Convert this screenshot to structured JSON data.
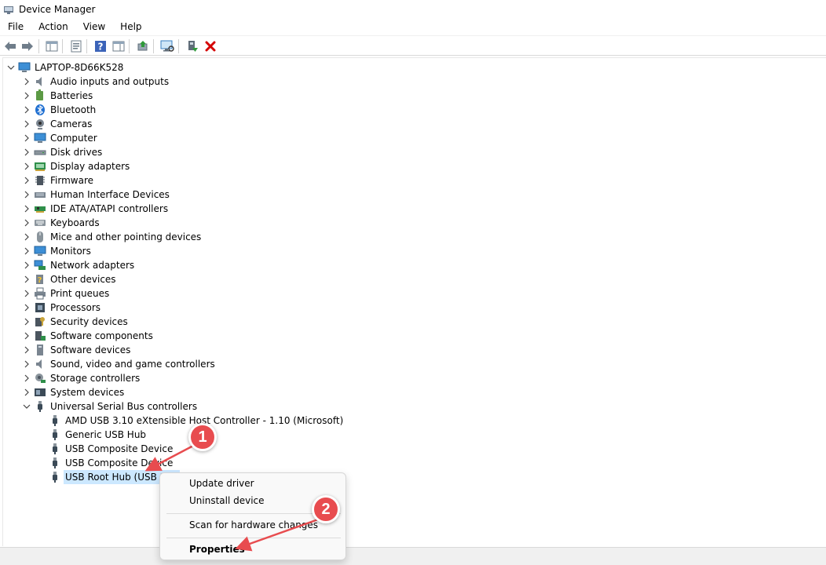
{
  "window": {
    "title": "Device Manager"
  },
  "menu": [
    "File",
    "Action",
    "View",
    "Help"
  ],
  "toolbar": {
    "buttons": [
      "back-icon",
      "forward-icon",
      "show-hide-console-tree-icon",
      "properties-icon",
      "help-icon",
      "action-pane-icon",
      "update-driver-icon",
      "scan-hardware-icon",
      "enable-device-icon",
      "uninstall-device-icon"
    ]
  },
  "tree": {
    "root": "LAPTOP-8D66K528",
    "categories": [
      {
        "label": "Audio inputs and outputs",
        "icon": "speaker-icon"
      },
      {
        "label": "Batteries",
        "icon": "battery-icon"
      },
      {
        "label": "Bluetooth",
        "icon": "bluetooth-icon"
      },
      {
        "label": "Cameras",
        "icon": "camera-icon"
      },
      {
        "label": "Computer",
        "icon": "computer-icon"
      },
      {
        "label": "Disk drives",
        "icon": "disk-drive-icon"
      },
      {
        "label": "Display adapters",
        "icon": "display-adapter-icon"
      },
      {
        "label": "Firmware",
        "icon": "firmware-icon"
      },
      {
        "label": "Human Interface Devices",
        "icon": "hid-icon"
      },
      {
        "label": "IDE ATA/ATAPI controllers",
        "icon": "ide-controller-icon"
      },
      {
        "label": "Keyboards",
        "icon": "keyboard-icon"
      },
      {
        "label": "Mice and other pointing devices",
        "icon": "mouse-icon"
      },
      {
        "label": "Monitors",
        "icon": "monitor-icon"
      },
      {
        "label": "Network adapters",
        "icon": "network-adapter-icon"
      },
      {
        "label": "Other devices",
        "icon": "other-devices-icon"
      },
      {
        "label": "Print queues",
        "icon": "printer-icon"
      },
      {
        "label": "Processors",
        "icon": "processor-icon"
      },
      {
        "label": "Security devices",
        "icon": "security-device-icon"
      },
      {
        "label": "Software components",
        "icon": "software-component-icon"
      },
      {
        "label": "Software devices",
        "icon": "software-device-icon"
      },
      {
        "label": "Sound, video and game controllers",
        "icon": "sound-controller-icon"
      },
      {
        "label": "Storage controllers",
        "icon": "storage-controller-icon"
      },
      {
        "label": "System devices",
        "icon": "system-devices-icon"
      },
      {
        "label": "Universal Serial Bus controllers",
        "icon": "usb-icon"
      }
    ],
    "usb_children": [
      "AMD USB 3.10 eXtensible Host Controller - 1.10 (Microsoft)",
      "Generic USB Hub",
      "USB Composite Device",
      "USB Composite Device",
      "USB Root Hub (USB 3.0)"
    ]
  },
  "context_menu": {
    "items": [
      "Update driver",
      "Uninstall device",
      "Scan for hardware changes",
      "Properties"
    ]
  },
  "annotations": [
    "1",
    "2"
  ],
  "colors": {
    "selection": "#cce8ff",
    "callout": "#e84c4f",
    "delete_red": "#d40000"
  }
}
